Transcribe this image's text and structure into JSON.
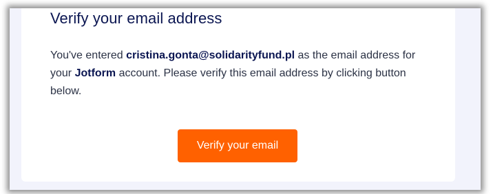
{
  "email_card": {
    "title": "Verify your email address",
    "message": {
      "part1": "You've entered ",
      "email": "cristina.gonta@solidarityfund.pl",
      "part2": " as the email address for your ",
      "brand": "Jotform",
      "part3": " account. Please verify this email address by clicking button below."
    },
    "button_label": "Verify your email"
  },
  "colors": {
    "accent": "#ff6100",
    "title": "#0a1551",
    "background": "#f2f3fc"
  }
}
